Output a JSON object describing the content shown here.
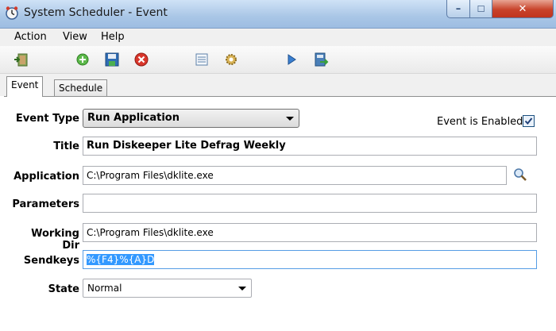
{
  "window": {
    "title": "System Scheduler - Event",
    "min_symbol": "–",
    "max_symbol": "☐",
    "close_symbol": "✕"
  },
  "menu": [
    "Action",
    "View",
    "Help"
  ],
  "toolbar": {
    "icons": [
      "exit-icon",
      "add-icon",
      "save-icon",
      "delete-icon",
      "list-icon",
      "settings-gear-icon",
      "run-play-icon",
      "export-icon"
    ]
  },
  "tabs": {
    "event": "Event",
    "schedule": "Schedule"
  },
  "form": {
    "event_type_label": "Event Type",
    "event_type_value": "Run Application",
    "enabled_label": "Event is Enabled",
    "enabled_checked": true,
    "title_label": "Title",
    "title_value": "Run Diskeeper Lite Defrag Weekly",
    "application_label": "Application",
    "application_value": "C:\\Program Files\\dklite.exe",
    "parameters_label": "Parameters",
    "parameters_value": "",
    "working_dir_label": "Working Dir",
    "working_dir_value": "C:\\Program Files\\dklite.exe",
    "sendkeys_label": "Sendkeys",
    "sendkeys_value": "%{F4}%{A}D",
    "state_label": "State",
    "state_value": "Normal"
  },
  "colors": {
    "selection": "#3399ff",
    "title_gradient_top": "#cfe2f6",
    "close_red": "#c8432b"
  }
}
